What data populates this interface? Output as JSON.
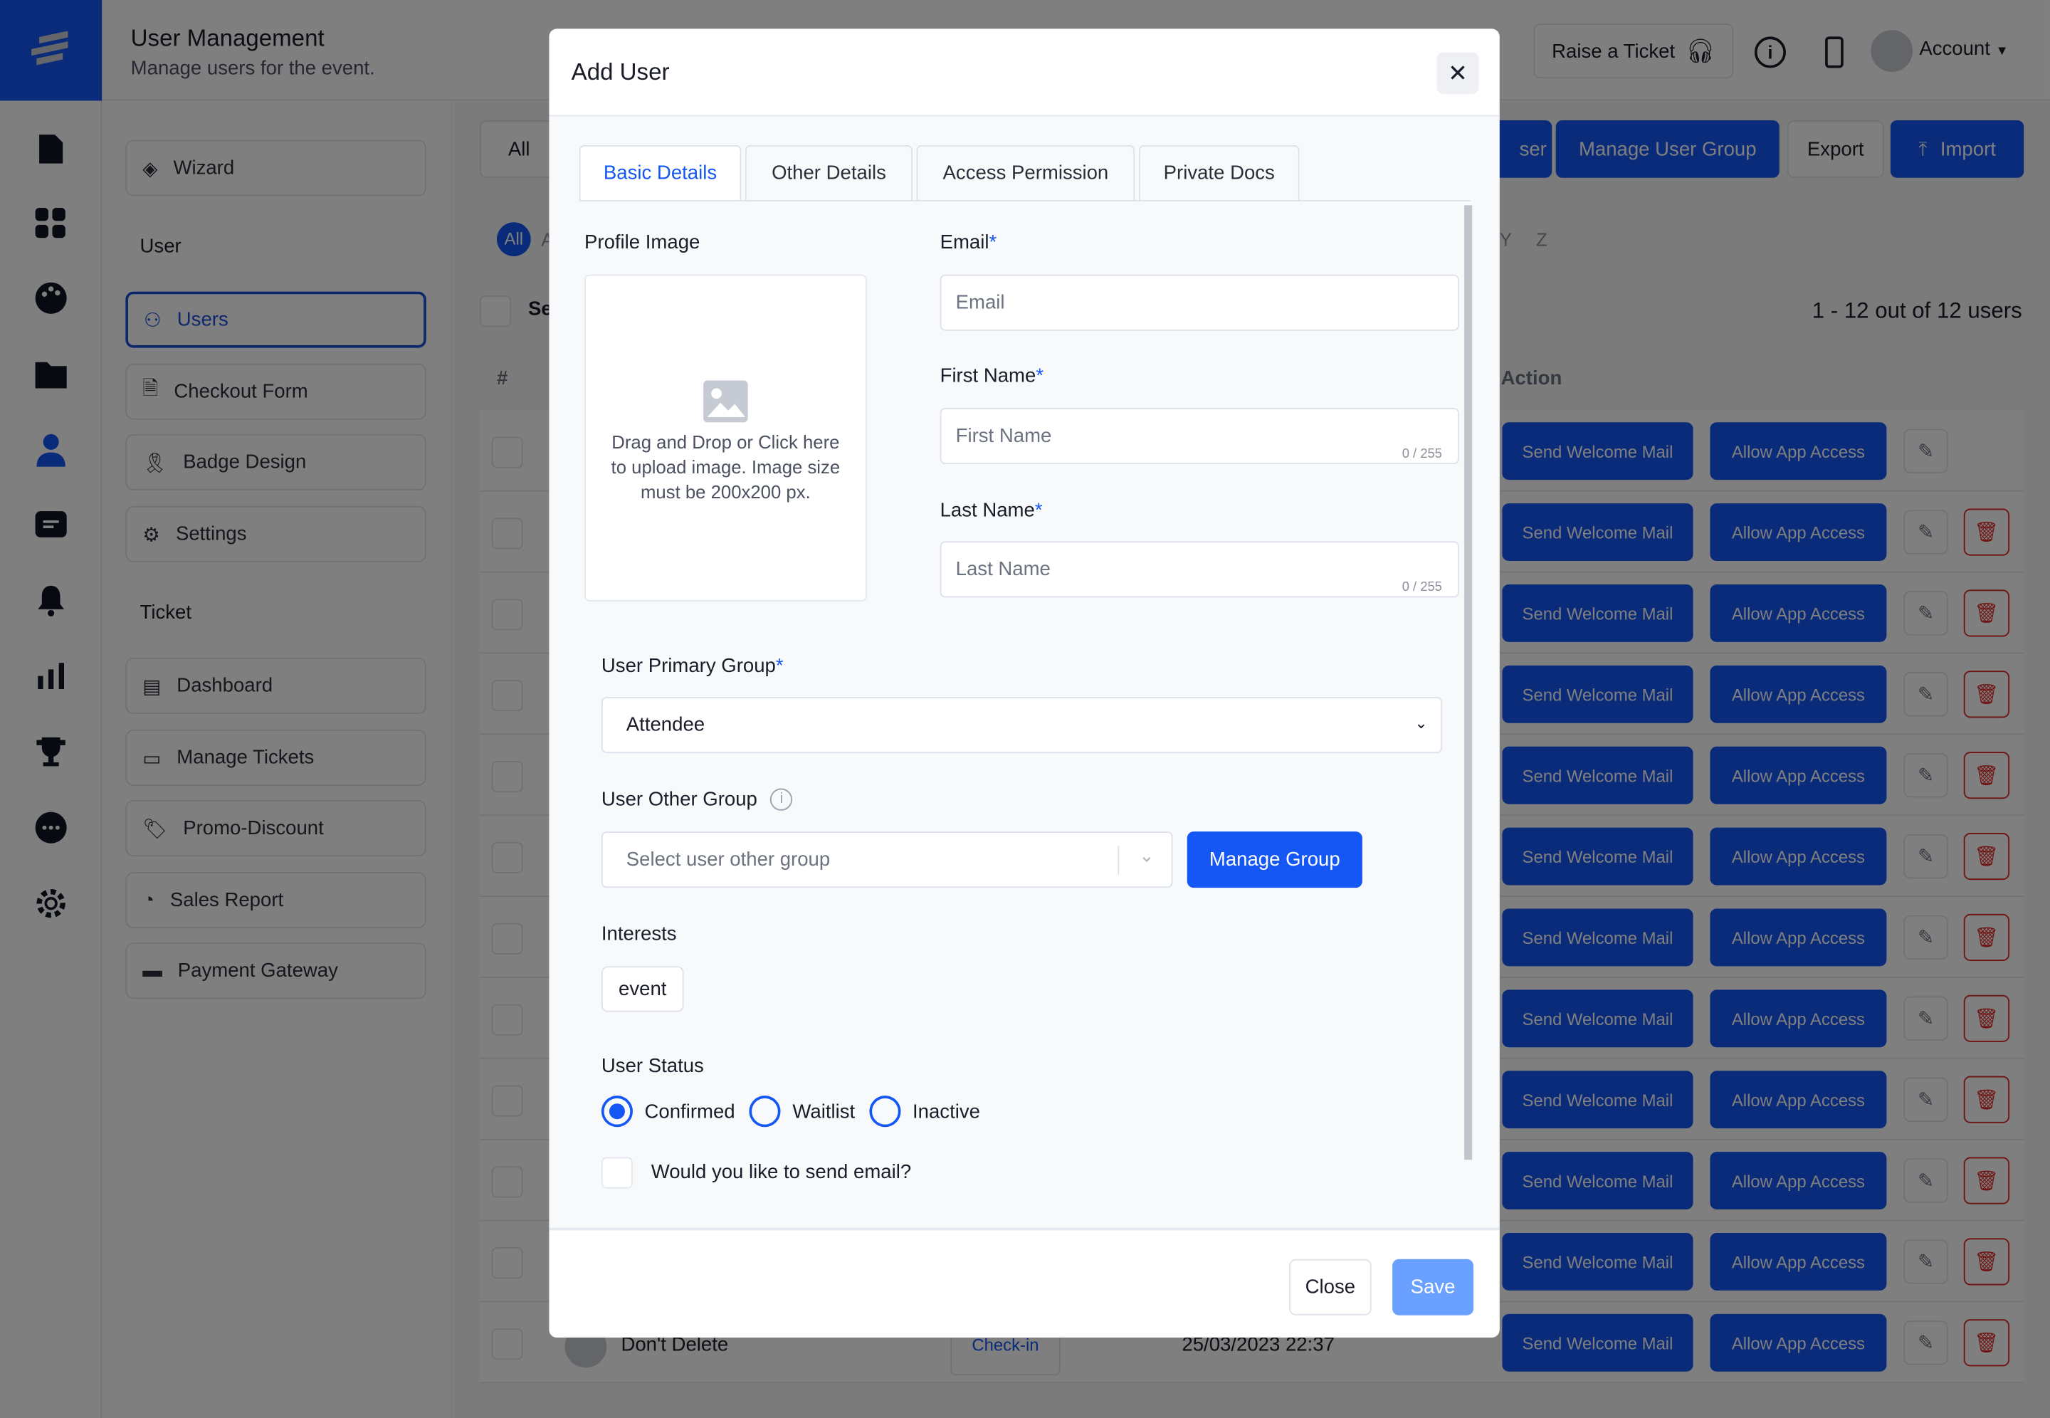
{
  "header": {
    "title": "User Management",
    "subtitle": "Manage users for the event.",
    "raise_ticket": "Raise a Ticket",
    "account": "Account"
  },
  "sidebar": {
    "wizard": "Wizard",
    "user_group": "User",
    "user_items": [
      "Users",
      "Checkout Form",
      "Badge Design",
      "Settings"
    ],
    "ticket_group": "Ticket",
    "ticket_items": [
      "Dashboard",
      "Manage Tickets",
      "Promo-Discount",
      "Sales Report",
      "Payment Gateway"
    ]
  },
  "toolbar": {
    "filter": "All",
    "add_user_partial": "ser",
    "manage_user_group": "Manage User Group",
    "export": "Export",
    "import": "Import"
  },
  "alphabet": {
    "all": "All",
    "a_partial": "A",
    "y": "Y",
    "z": "Z"
  },
  "table": {
    "select_partial": "Se",
    "hash": "#",
    "action_header": "Action",
    "count": "1 - 12 out of 12 users",
    "send_welcome": "Send Welcome Mail",
    "allow_app": "Allow App Access",
    "last_row": {
      "name": "Don't Delete",
      "status": "Check-in",
      "date": "25/03/2023 22:37"
    }
  },
  "modal": {
    "title": "Add User",
    "tabs": [
      "Basic Details",
      "Other Details",
      "Access Permission",
      "Private Docs"
    ],
    "active_tab": "Basic Details",
    "profile_image_label": "Profile Image",
    "upload_text": "Drag and Drop or Click here to upload image. Image size must be 200x200 px.",
    "email_label": "Email",
    "email_placeholder": "Email",
    "first_name_label": "First Name",
    "first_name_placeholder": "First Name",
    "first_name_counter": "0 / 255",
    "last_name_label": "Last Name",
    "last_name_placeholder": "Last Name",
    "last_name_counter": "0 / 255",
    "required_mark": "*",
    "primary_group_label": "User Primary Group",
    "primary_group_value": "Attendee",
    "other_group_label": "User Other Group",
    "other_group_placeholder": "Select user other group",
    "manage_group": "Manage Group",
    "interests_label": "Interests",
    "interests": [
      "event"
    ],
    "status_label": "User Status",
    "status_options": [
      "Confirmed",
      "Waitlist",
      "Inactive"
    ],
    "status_selected": "Confirmed",
    "send_email_label": "Would you like to send email?",
    "send_email_checked": false,
    "close": "Close",
    "save": "Save"
  },
  "colors": {
    "primary": "#1457f5",
    "danger": "#e02424",
    "save_disabled": "#6aa0ff"
  }
}
